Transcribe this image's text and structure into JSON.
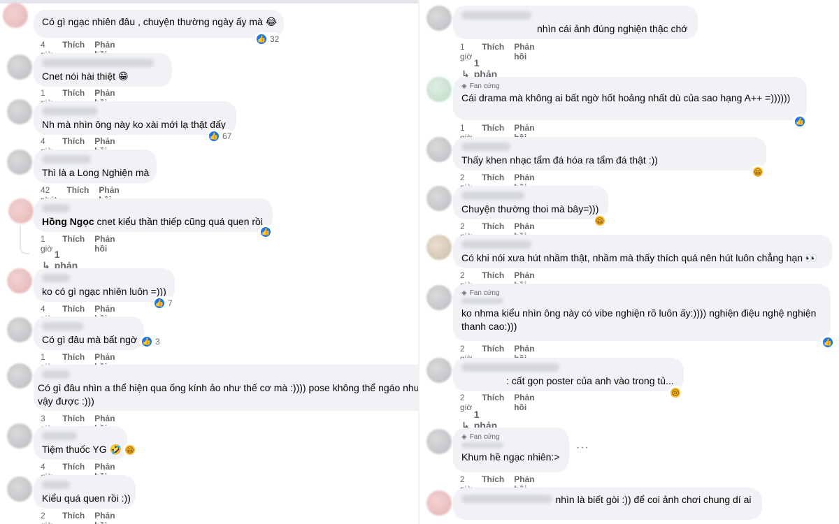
{
  "actions": {
    "like": "Thích",
    "reply": "Phản hồi"
  },
  "badge_label": "Fan cứng",
  "left": {
    "comments": [
      {
        "text": "Có gì ngạc nhiên đâu , chuyện thường ngày ấy mà 😂",
        "time": "4 giờ",
        "reactions": "32"
      },
      {
        "text": "Cnet nói hài thiệt 😁",
        "time": "1 giờ"
      },
      {
        "text": "Nh mà nhìn ông này ko xài mới lạ thật đấy",
        "time": "4 giờ",
        "reactions": "67"
      },
      {
        "text": "Thì là a Long Nghiện mà",
        "time": "42 phút"
      },
      {
        "author": "Hồng Ngọc",
        "text": "cnet kiểu thần thiếp cũng quá quen rồi",
        "time": "1 giờ",
        "replies": "1 phản hồi"
      },
      {
        "text": "ko có gì ngạc nhiên luôn =)))",
        "time": "4 giờ",
        "reactions": "7"
      },
      {
        "text": "Có gì đâu mà bất ngờ",
        "time": "1 giờ",
        "reactions": "3"
      },
      {
        "text": "Có gì đâu nhìn a thể hiện qua ống kính ảo như thế cơ mà :)))) pose không thể ngáo nhu",
        "text2": "vậy được :)))",
        "time": "3 giờ"
      },
      {
        "text": "Tiệm thuốc YG 🤣",
        "time": "4 giờ"
      },
      {
        "text": "Kiểu quá quen rồi :))",
        "time": "2 giờ"
      }
    ]
  },
  "right": {
    "comments": [
      {
        "text": "nhìn cái ảnh đúng nghiện thậc chớ",
        "time": "1 giờ",
        "replies": "1 phản hồi"
      },
      {
        "text": "Cái drama mà không ai bất ngờ hốt hoảng nhất dù của sao hạng A++ =))))))",
        "time": "1 giờ"
      },
      {
        "text": "Thấy khen nhạc tẩm đá hóa ra tẩm đá thật :))",
        "time": "2 giờ"
      },
      {
        "text": "Chuyện thường thoi mà bây=)))",
        "time": "2 giờ"
      },
      {
        "text": "Có khi nói xưa hút nhầm thật, nhầm mà thấy thích quá nên hút luôn chẳng hạn 👀",
        "time": "2 giờ"
      },
      {
        "text": "ko nhma kiểu nhìn ông này có vibe nghiện rõ luôn ấy:)))) nghiện điệu nghệ nghiện",
        "text2": "thanh cao:)))",
        "time": "2 giờ"
      },
      {
        "text": ": cất gọn poster của anh vào trong tủ...",
        "time": "2 giờ",
        "replies": "1 phản hồi"
      },
      {
        "text": "Khum hề ngạc nhiên:>",
        "time": "2 giờ",
        "more": "···"
      },
      {
        "text": "nhìn là biết gòi :)) để coi ảnh chơi chung dí ai"
      }
    ]
  }
}
